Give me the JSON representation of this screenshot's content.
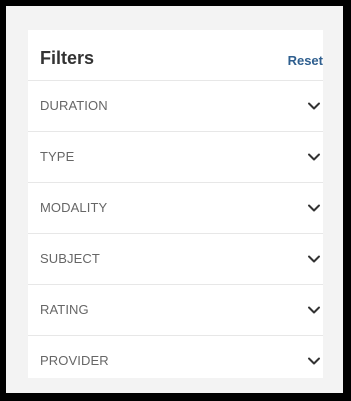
{
  "filters": {
    "title": "Filters",
    "reset_label": "Reset",
    "sections": [
      {
        "label": "DURATION"
      },
      {
        "label": "TYPE"
      },
      {
        "label": "MODALITY"
      },
      {
        "label": "SUBJECT"
      },
      {
        "label": "RATING"
      },
      {
        "label": "PROVIDER"
      }
    ]
  },
  "colors": {
    "background": "#000000",
    "frame": "#f3f3f3",
    "panel": "#ffffff",
    "title": "#333333",
    "link": "#2f5f8f",
    "label": "#666666",
    "divider": "#e7e7e7"
  },
  "icons": {
    "expand": "chevron-down-icon"
  }
}
